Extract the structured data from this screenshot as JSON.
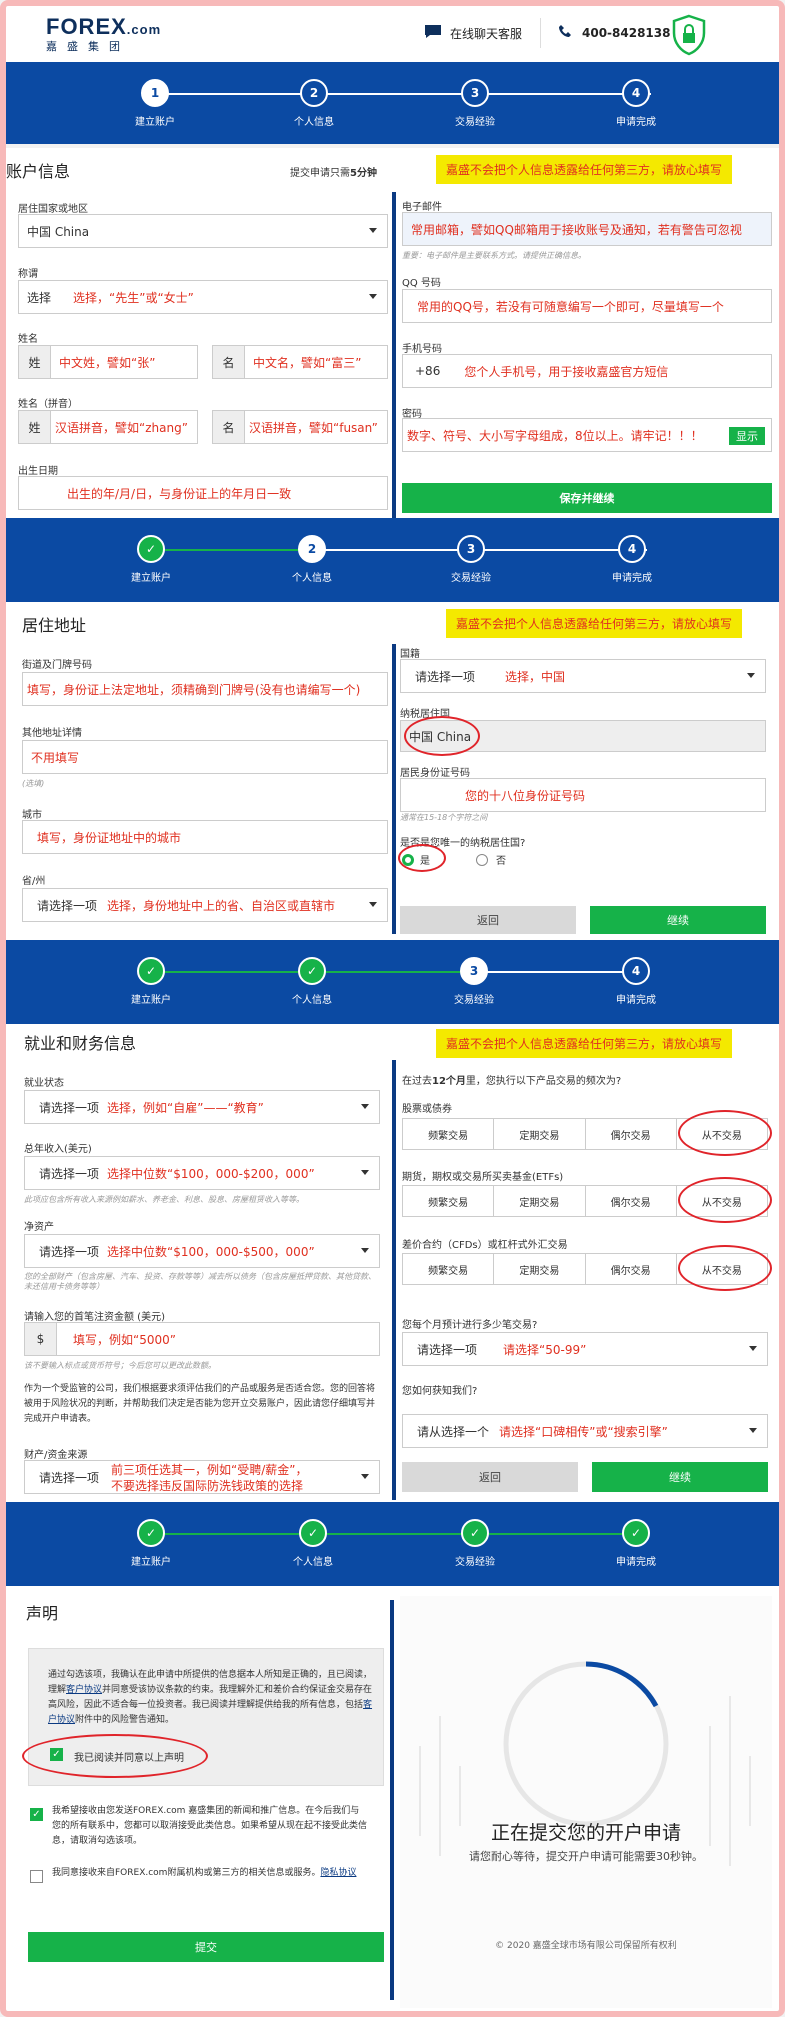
{
  "header": {
    "logo_main": "FOREX",
    "logo_com": ".com",
    "logo_sub": "嘉盛集团",
    "chat": "在线聊天客服",
    "phone": "400-8428138"
  },
  "steps": {
    "s1": "建立账户",
    "s2": "个人信息",
    "s3": "交易经验",
    "s4": "申请完成"
  },
  "notice": "嘉盛不会把个人信息透露给任何第三方，请放心填写",
  "account": {
    "title": "账户信息",
    "time_text": "提交申请只需",
    "time_bold": "5分钟",
    "country_label": "居住国家或地区",
    "country_value": "中国 China",
    "salutation_label": "称谓",
    "salutation_value": "选择",
    "salutation_note": "选择，“先生”或“女士”",
    "name_label": "姓名",
    "surname_pre": "姓",
    "surname_note": "中文姓，譬如“张”",
    "given_pre": "名",
    "given_note": "中文名，譬如“富三”",
    "pinyin_label": "姓名（拼音）",
    "pinyin_sur_pre": "姓",
    "pinyin_sur_note": "汉语拼音，譬如“zhang”",
    "pinyin_given_pre": "名",
    "pinyin_given_note": "汉语拼音，譬如“fusan”",
    "dob_label": "出生日期",
    "dob_note": "出生的年/月/日，与身份证上的年月日一致",
    "email_label": "电子邮件",
    "email_note": "常用邮箱，譬如QQ邮箱用于接收账号及通知，若有警告可忽视",
    "email_hint": "重要：电子邮件是主要联系方式。请提供正确信息。",
    "qq_label": "QQ 号码",
    "qq_note": "常用的QQ号，若没有可随意编写一个即可，尽量填写一个",
    "phone_label": "手机号码",
    "phone_code": "+86",
    "phone_note": "您个人手机号，用于接收嘉盛官方短信",
    "password_label": "密码",
    "password_note": "数字、符号、大小写字母组成，8位以上。请牢记！！！",
    "show_label": "显示",
    "save_button": "保存并继续"
  },
  "address": {
    "title": "居住地址",
    "street_label": "街道及门牌号码",
    "street_note": "填写，身份证上法定地址，须精确到门牌号(没有也请编写一个)",
    "other_label": "其他地址详情",
    "other_note": "不用填写",
    "optional": "(选填)",
    "city_label": "城市",
    "city_note": "填写，身份证地址中的城市",
    "province_label": "省/州",
    "province_value": "请选择一项",
    "province_note": "选择，身份地址中上的省、自治区或直辖市",
    "nationality_label": "国籍",
    "nationality_value": "请选择一项",
    "nationality_note": "选择，中国",
    "tax_label": "纳税居住国",
    "tax_value": "中国 China",
    "id_label": "居民身份证号码",
    "id_note": "您的十八位身份证号码",
    "id_hint": "通常在15-18个字符之间",
    "only_tax_label": "是否是您唯一的纳税居住国?",
    "yes": "是",
    "no": "否",
    "back_button": "返回",
    "next_button": "继续"
  },
  "employment": {
    "title": "就业和财务信息",
    "status_label": "就业状态",
    "status_value": "请选择一项",
    "status_note": "选择，例如“自雇”——“教育”",
    "income_label": "总年收入(美元)",
    "income_value": "请选择一项",
    "income_note": "选择中位数“$100，000-$200，000”",
    "income_hint": "此项应包含所有收入来源例如薪水、养老金、利息、股息、房屋租赁收入等等。",
    "assets_label": "净资产",
    "assets_value": "请选择一项",
    "assets_note": "选择中位数“$100，000-$500，000”",
    "assets_hint1": "您的全部财产（包含房屋、汽车、投资、存款等等）减去所以债务（包含房屋抵押贷款、其他贷款、未还信用卡债务等等）",
    "deposit_label": "请输入您的首笔注资金额 (美元)",
    "deposit_pre": "$",
    "deposit_note": "填写，例如“5000”",
    "deposit_hint": "该不要输入标点或货币符号；今后您可以更改此数额。",
    "reg_text": "作为一个受监管的公司，我们根据要求须评估我们的产品或服务是否适合您。您的回答将被用于风险状况的判断，并帮助我们决定是否能为您开立交易账户，因此请您仔细填写并完成开户申请表。",
    "source_label": "财产/资金来源",
    "source_value": "请选择一项",
    "source_note1": "前三项任选其一，例如“受聘/薪金”，",
    "source_note2": "不要选择违反国际防洗钱政策的选择",
    "freq_q_pre": "在过去",
    "freq_q_bold": "12个月",
    "freq_q_post": "里，您执行以下产品交易的频次为?",
    "stocks_label": "股票或债券",
    "futures_label": "期货，期权或交易所买卖基金(ETFs)",
    "cfd_label": "差价合约（CFDs）或杠杆式外汇交易",
    "opt1": "频繁交易",
    "opt2": "定期交易",
    "opt3": "偶尔交易",
    "opt4": "从不交易",
    "monthly_label": "您每个月预计进行多少笔交易?",
    "monthly_value": "请选择一项",
    "monthly_note": "请选择“50-99”",
    "how_label": "您如何获知我们?",
    "how_value": "请从选择一个",
    "how_note": "请选择“口碑相传”或“搜索引擎”",
    "back_button": "返回",
    "next_button": "继续"
  },
  "declaration": {
    "title": "声明",
    "box_text1": "通过勾选该项，我确认在此申请中所提供的信息据本人所知是正确的，且已阅读，理解",
    "box_link1": "客户协议",
    "box_text2": "并同意受该协议条款的约束。我理解外汇和差价合约保证金交易存在高风险，因此不适合每一位投资者。我已阅读并理解提供给我的所有信息，包括",
    "box_link2": "客户协议",
    "box_text3": "附件中的风险警告通知。",
    "check1_label": "我已阅读并同意以上声明",
    "check2_text": "我希望接收由您发送FOREX.com 嘉盛集团的新闻和推广信息。在今后我们与您的所有联系中，您都可以取消接受此类信息。如果希望从现在起不接受此类信息，请取消勾选该项。",
    "check3_text": "我同意接收来自FOREX.com附属机构或第三方的相关信息或服务。",
    "check3_link": "隐私协议",
    "submit_button": "提交",
    "submitting_title": "正在提交您的开户申请",
    "submitting_sub": "请您耐心等待，提交开户申请可能需要30秒钟。",
    "copyright": "© 2020 嘉盛全球市场有限公司保留所有权利"
  },
  "colors": {
    "brand_blue": "#0b4aa3",
    "green": "#16b249",
    "note_red": "#e03020",
    "notice_yellow": "#f4e900"
  }
}
